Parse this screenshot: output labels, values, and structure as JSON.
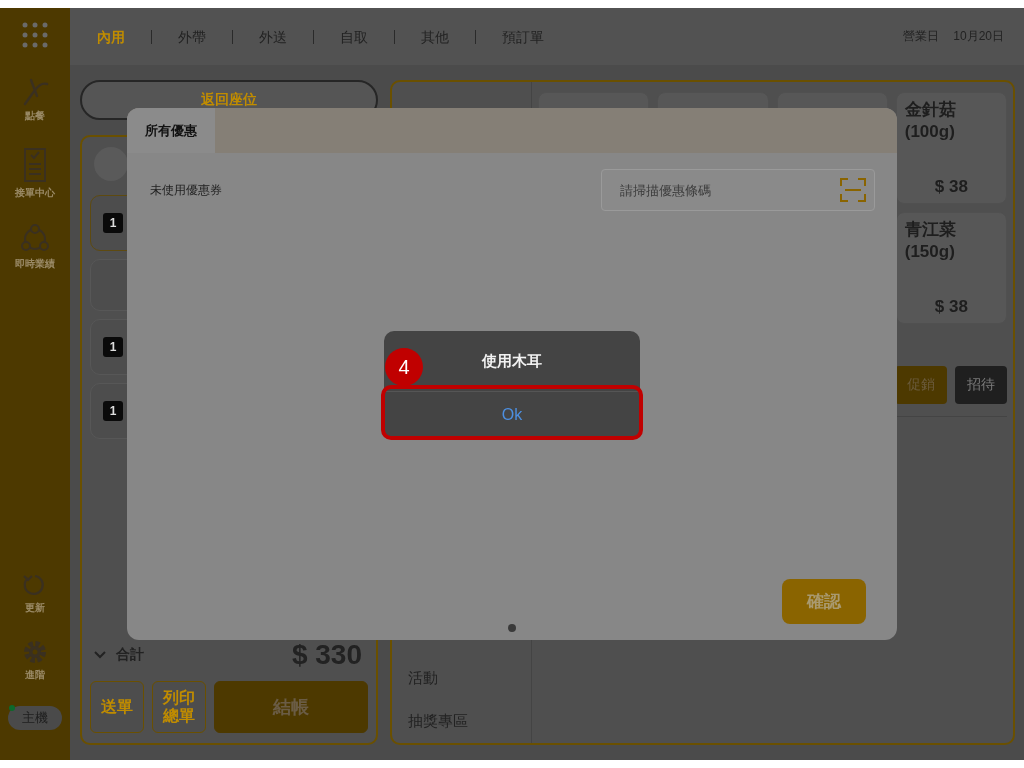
{
  "sidebar": {
    "items": [
      {
        "label": "點餐",
        "kind": "order"
      },
      {
        "label": "接單中心",
        "kind": "clipboard"
      },
      {
        "label": "即時業績",
        "kind": "network"
      }
    ],
    "bottom_items": [
      {
        "label": "更新",
        "kind": "refresh"
      },
      {
        "label": "進階",
        "kind": "gear"
      }
    ],
    "host_badge": "主機"
  },
  "tabs": [
    {
      "label": "內用",
      "selected": true
    },
    {
      "label": "外帶",
      "selected": false
    },
    {
      "label": "外送",
      "selected": false
    },
    {
      "label": "自取",
      "selected": false
    },
    {
      "label": "其他",
      "selected": false
    },
    {
      "label": "預訂單",
      "selected": false
    }
  ],
  "business_day": {
    "label": "營業日",
    "date": "10月20日"
  },
  "back_button": "返回座位",
  "order_items": [
    {
      "quantity": "1"
    },
    {
      "quantity": "1"
    },
    {
      "quantity": "1"
    }
  ],
  "total": {
    "label": "合計",
    "amount": "$ 330"
  },
  "order_buttons": [
    {
      "label": "送單",
      "kind": "outline"
    },
    {
      "label": "列印總單",
      "kind": "outline"
    },
    {
      "label": "結帳",
      "kind": "primary"
    }
  ],
  "categories": [
    "活動",
    "抽獎專區"
  ],
  "products": [
    {
      "name": "金針菇",
      "unit": "(100g)",
      "price": "$ 38"
    },
    {
      "name": "青江菜",
      "unit": "(150g)",
      "price": "$ 38"
    }
  ],
  "action_buttons": [
    {
      "label": "促銷",
      "kind": "promo"
    },
    {
      "label": "招待",
      "kind": "comp"
    }
  ],
  "modal": {
    "tabs": [
      {
        "label": "所有優惠",
        "selected": true
      }
    ],
    "section_label": "未使用優惠券",
    "scan_field": {
      "placeholder": "請掃描優惠條碼"
    },
    "confirm_button": "確認"
  },
  "alert": {
    "title": "使用木耳",
    "button": "Ok"
  },
  "step_badge": "4"
}
